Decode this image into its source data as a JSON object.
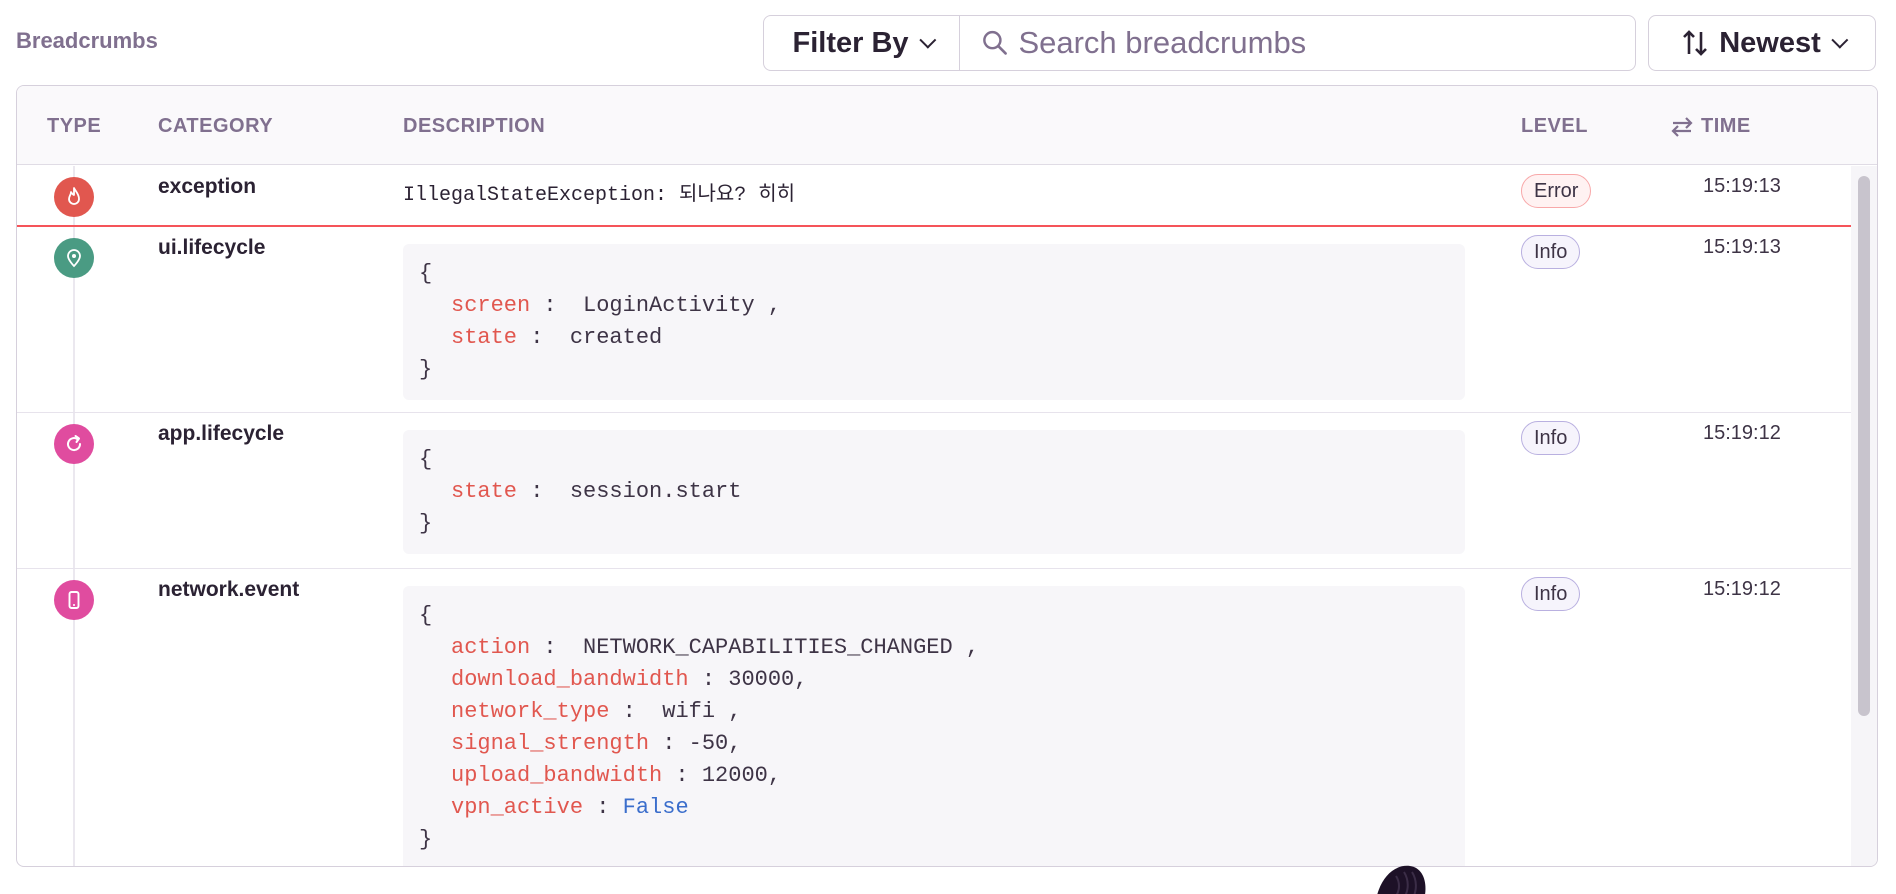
{
  "header": {
    "title": "Breadcrumbs",
    "filter_label": "Filter By",
    "search_placeholder": "Search breadcrumbs",
    "sort_label": "Newest"
  },
  "table": {
    "columns": {
      "type": "TYPE",
      "category": "CATEGORY",
      "description": "DESCRIPTION",
      "level": "LEVEL",
      "time": "TIME"
    },
    "rows": [
      {
        "icon": "fire-icon",
        "icon_color": "#e1574f",
        "category": "exception",
        "description": "IllegalStateException: 되나요? 히히",
        "level": "Error",
        "time": "15:19:13"
      },
      {
        "icon": "location-pin-icon",
        "icon_color": "#4a9b83",
        "category": "ui.lifecycle",
        "level": "Info",
        "time": "15:19:13",
        "data": {
          "open": "{",
          "close": "}",
          "fields": [
            {
              "key": "screen",
              "sep": " :  ",
              "value": "LoginActivity",
              "trail": " ,"
            },
            {
              "key": "state",
              "sep": " :  ",
              "value": "created",
              "trail": ""
            }
          ]
        }
      },
      {
        "icon": "refresh-icon",
        "icon_color": "#e04c9f",
        "category": "app.lifecycle",
        "level": "Info",
        "time": "15:19:12",
        "data": {
          "open": "{",
          "close": "}",
          "fields": [
            {
              "key": "state",
              "sep": " :  ",
              "value": "session.start",
              "trail": ""
            }
          ]
        }
      },
      {
        "icon": "mobile-device-icon",
        "icon_color": "#e04c9f",
        "category": "network.event",
        "level": "Info",
        "time": "15:19:12",
        "data": {
          "open": "{",
          "close": "}",
          "fields": [
            {
              "key": "action",
              "sep": " :  ",
              "value": "NETWORK_CAPABILITIES_CHANGED",
              "trail": " ,"
            },
            {
              "key": "download_bandwidth",
              "sep": " : ",
              "value": "30000",
              "trail": ","
            },
            {
              "key": "network_type",
              "sep": " :  ",
              "value": "wifi",
              "trail": " ,"
            },
            {
              "key": "signal_strength",
              "sep": " : ",
              "value": "-50",
              "trail": ","
            },
            {
              "key": "upload_bandwidth",
              "sep": " : ",
              "value": "12000",
              "trail": ","
            },
            {
              "key": "vpn_active",
              "sep": " : ",
              "value": "False",
              "trail": ""
            }
          ]
        }
      }
    ]
  }
}
